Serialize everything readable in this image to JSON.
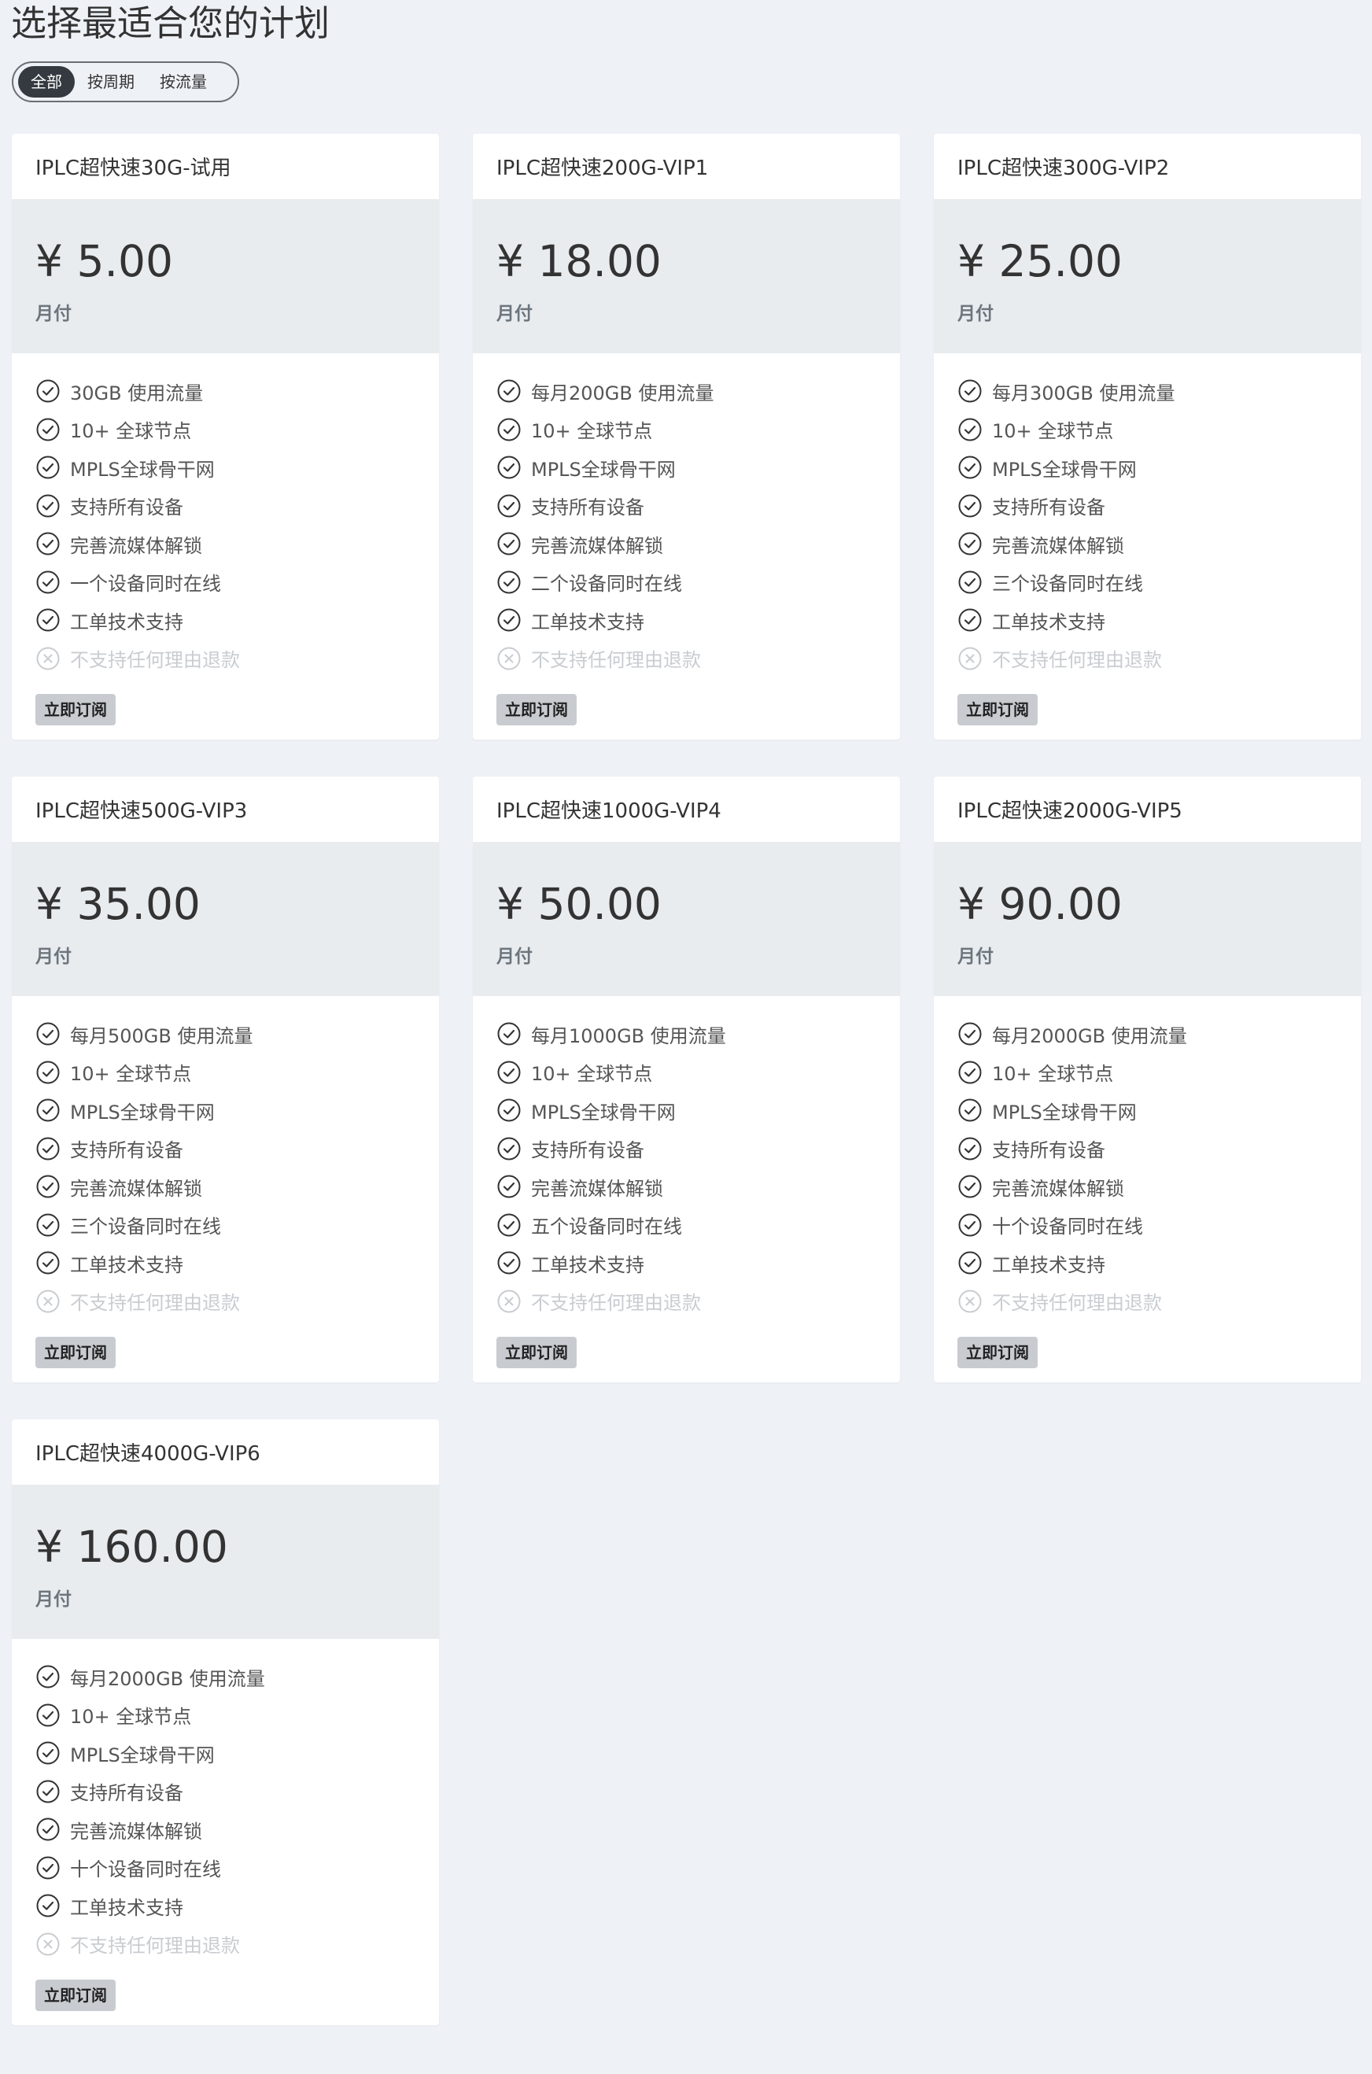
{
  "page": {
    "title": "选择最适合您的计划"
  },
  "filters": [
    {
      "label": "全部",
      "active": true
    },
    {
      "label": "按周期",
      "active": false
    },
    {
      "label": "按流量",
      "active": false
    }
  ],
  "plans": [
    {
      "name": "IPLC超快速30G-试用",
      "price": "¥ 5.00",
      "period": "月付",
      "features": [
        {
          "text": "30GB 使用流量",
          "included": true
        },
        {
          "text": "10+ 全球节点",
          "included": true
        },
        {
          "text": "MPLS全球骨干网",
          "included": true
        },
        {
          "text": "支持所有设备",
          "included": true
        },
        {
          "text": "完善流媒体解锁",
          "included": true
        },
        {
          "text": "一个设备同时在线",
          "included": true
        },
        {
          "text": "工单技术支持",
          "included": true
        },
        {
          "text": "不支持任何理由退款",
          "included": false
        }
      ],
      "button": "立即订阅"
    },
    {
      "name": "IPLC超快速200G-VIP1",
      "price": "¥ 18.00",
      "period": "月付",
      "features": [
        {
          "text": "每月200GB 使用流量",
          "included": true
        },
        {
          "text": "10+ 全球节点",
          "included": true
        },
        {
          "text": "MPLS全球骨干网",
          "included": true
        },
        {
          "text": "支持所有设备",
          "included": true
        },
        {
          "text": "完善流媒体解锁",
          "included": true
        },
        {
          "text": "二个设备同时在线",
          "included": true
        },
        {
          "text": "工单技术支持",
          "included": true
        },
        {
          "text": "不支持任何理由退款",
          "included": false
        }
      ],
      "button": "立即订阅"
    },
    {
      "name": "IPLC超快速300G-VIP2",
      "price": "¥ 25.00",
      "period": "月付",
      "features": [
        {
          "text": "每月300GB 使用流量",
          "included": true
        },
        {
          "text": "10+ 全球节点",
          "included": true
        },
        {
          "text": "MPLS全球骨干网",
          "included": true
        },
        {
          "text": "支持所有设备",
          "included": true
        },
        {
          "text": "完善流媒体解锁",
          "included": true
        },
        {
          "text": "三个设备同时在线",
          "included": true
        },
        {
          "text": "工单技术支持",
          "included": true
        },
        {
          "text": "不支持任何理由退款",
          "included": false
        }
      ],
      "button": "立即订阅"
    },
    {
      "name": "IPLC超快速500G-VIP3",
      "price": "¥ 35.00",
      "period": "月付",
      "features": [
        {
          "text": "每月500GB 使用流量",
          "included": true
        },
        {
          "text": "10+ 全球节点",
          "included": true
        },
        {
          "text": "MPLS全球骨干网",
          "included": true
        },
        {
          "text": "支持所有设备",
          "included": true
        },
        {
          "text": "完善流媒体解锁",
          "included": true
        },
        {
          "text": "三个设备同时在线",
          "included": true
        },
        {
          "text": "工单技术支持",
          "included": true
        },
        {
          "text": "不支持任何理由退款",
          "included": false
        }
      ],
      "button": "立即订阅"
    },
    {
      "name": "IPLC超快速1000G-VIP4",
      "price": "¥ 50.00",
      "period": "月付",
      "features": [
        {
          "text": "每月1000GB 使用流量",
          "included": true
        },
        {
          "text": "10+ 全球节点",
          "included": true
        },
        {
          "text": "MPLS全球骨干网",
          "included": true
        },
        {
          "text": "支持所有设备",
          "included": true
        },
        {
          "text": "完善流媒体解锁",
          "included": true
        },
        {
          "text": "五个设备同时在线",
          "included": true
        },
        {
          "text": "工单技术支持",
          "included": true
        },
        {
          "text": "不支持任何理由退款",
          "included": false
        }
      ],
      "button": "立即订阅"
    },
    {
      "name": "IPLC超快速2000G-VIP5",
      "price": "¥ 90.00",
      "period": "月付",
      "features": [
        {
          "text": "每月2000GB 使用流量",
          "included": true
        },
        {
          "text": "10+ 全球节点",
          "included": true
        },
        {
          "text": "MPLS全球骨干网",
          "included": true
        },
        {
          "text": "支持所有设备",
          "included": true
        },
        {
          "text": "完善流媒体解锁",
          "included": true
        },
        {
          "text": "十个设备同时在线",
          "included": true
        },
        {
          "text": "工单技术支持",
          "included": true
        },
        {
          "text": "不支持任何理由退款",
          "included": false
        }
      ],
      "button": "立即订阅"
    },
    {
      "name": "IPLC超快速4000G-VIP6",
      "price": "¥ 160.00",
      "period": "月付",
      "features": [
        {
          "text": "每月2000GB 使用流量",
          "included": true
        },
        {
          "text": "10+ 全球节点",
          "included": true
        },
        {
          "text": "MPLS全球骨干网",
          "included": true
        },
        {
          "text": "支持所有设备",
          "included": true
        },
        {
          "text": "完善流媒体解锁",
          "included": true
        },
        {
          "text": "十个设备同时在线",
          "included": true
        },
        {
          "text": "工单技术支持",
          "included": true
        },
        {
          "text": "不支持任何理由退款",
          "included": false
        }
      ],
      "button": "立即订阅"
    }
  ],
  "icons": {
    "included": "check-circle-icon",
    "excluded": "x-circle-icon"
  },
  "colors": {
    "page_background": "#eef1f6",
    "price_background": "#e9ecef",
    "active_filter": "#343a40",
    "button_background": "#c8ccd0",
    "disabled_text": "#c9ccd0"
  }
}
